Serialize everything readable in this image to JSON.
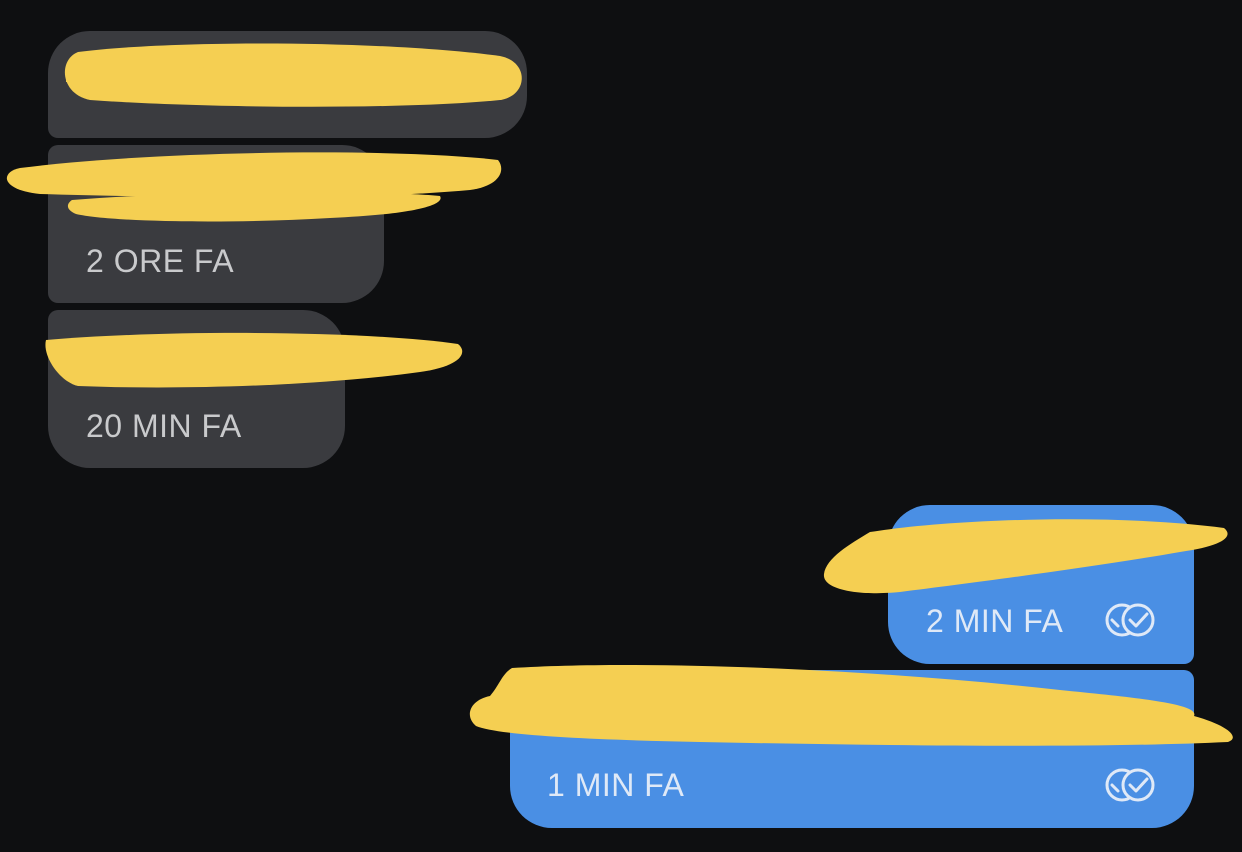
{
  "messages": [
    {
      "direction": "incoming",
      "time": ""
    },
    {
      "direction": "incoming",
      "time": "2 ORE FA"
    },
    {
      "direction": "incoming",
      "time": "20 MIN FA"
    },
    {
      "direction": "outgoing",
      "time": "2 MIN FA",
      "status_icon": "double-check-icon"
    },
    {
      "direction": "outgoing",
      "time": "1 MIN FA",
      "status_icon": "double-check-icon"
    }
  ],
  "colors": {
    "background": "#0e0f11",
    "incoming_bubble": "#3a3b3f",
    "outgoing_bubble": "#4a8fe4",
    "redaction": "#f5cf52"
  }
}
